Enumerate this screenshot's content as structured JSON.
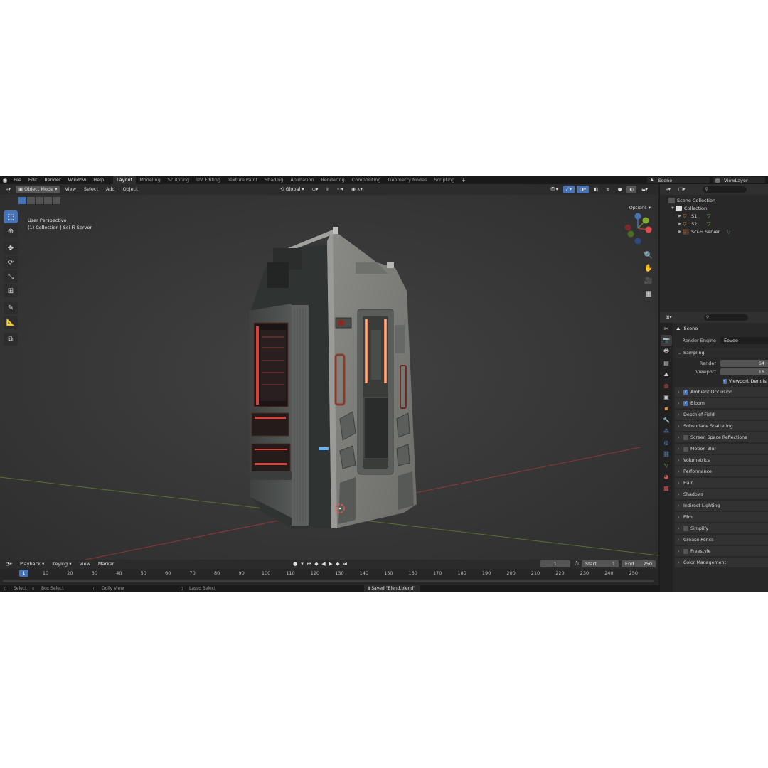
{
  "app": {
    "menus": [
      "File",
      "Edit",
      "Render",
      "Window",
      "Help"
    ],
    "workspaces": [
      "Layout",
      "Modeling",
      "Sculpting",
      "UV Editing",
      "Texture Paint",
      "Shading",
      "Animation",
      "Rendering",
      "Compositing",
      "Geometry Nodes",
      "Scripting"
    ],
    "active_workspace": "Layout",
    "scene_name": "Scene",
    "view_layer": "ViewLayer"
  },
  "viewport": {
    "mode": "Object Mode",
    "menus": [
      "View",
      "Select",
      "Add",
      "Object"
    ],
    "transform_orientation": "Global",
    "perspective_label": "User Perspective",
    "collection_label": "(1) Collection | Sci-Fi Server",
    "options_label": "Options",
    "colors": {
      "background": "#3c3c3c",
      "x_axis": "#b33a3a",
      "y_axis": "#6b8a2f",
      "accent": "#4772b3"
    }
  },
  "timeline": {
    "menus": [
      "Playback",
      "Keying",
      "View",
      "Marker"
    ],
    "current_frame": "1",
    "start_label": "Start",
    "start": "1",
    "end_label": "End",
    "end": "250",
    "ruler": [
      "10",
      "20",
      "30",
      "40",
      "50",
      "60",
      "70",
      "80",
      "90",
      "100",
      "110",
      "120",
      "130",
      "140",
      "150",
      "160",
      "170",
      "180",
      "190",
      "200",
      "210",
      "220",
      "230",
      "240",
      "250"
    ],
    "cursor_label": "1"
  },
  "statusbar": {
    "select": "Select",
    "box_select": "Box Select",
    "dolly_view": "Dolly View",
    "lasso_select": "Lasso Select",
    "message": "Saved \"Blend.blend\""
  },
  "outliner": {
    "root": "Scene Collection",
    "collection": "Collection",
    "objects": [
      "S1",
      "S2",
      "Sci-Fi Server"
    ]
  },
  "properties": {
    "context_title": "Scene",
    "render_engine_label": "Render Engine",
    "render_engine": "Eevee",
    "sampling": {
      "title": "Sampling",
      "render_label": "Render",
      "render": "64",
      "viewport_label": "Viewport",
      "viewport": "16",
      "denoise_label": "Viewport Denoising"
    },
    "panels": [
      {
        "label": "Ambient Occlusion",
        "check": "on"
      },
      {
        "label": "Bloom",
        "check": "on"
      },
      {
        "label": "Depth of Field",
        "check": "none"
      },
      {
        "label": "Subsurface Scattering",
        "check": "none"
      },
      {
        "label": "Screen Space Reflections",
        "check": "off"
      },
      {
        "label": "Motion Blur",
        "check": "off"
      },
      {
        "label": "Volumetrics",
        "check": "none"
      },
      {
        "label": "Performance",
        "check": "none"
      },
      {
        "label": "Hair",
        "check": "none"
      },
      {
        "label": "Shadows",
        "check": "none"
      },
      {
        "label": "Indirect Lighting",
        "check": "none"
      },
      {
        "label": "Film",
        "check": "none"
      },
      {
        "label": "Simplify",
        "check": "off"
      },
      {
        "label": "Grease Pencil",
        "check": "none"
      },
      {
        "label": "Freestyle",
        "check": "off"
      },
      {
        "label": "Color Management",
        "check": "none"
      }
    ]
  }
}
